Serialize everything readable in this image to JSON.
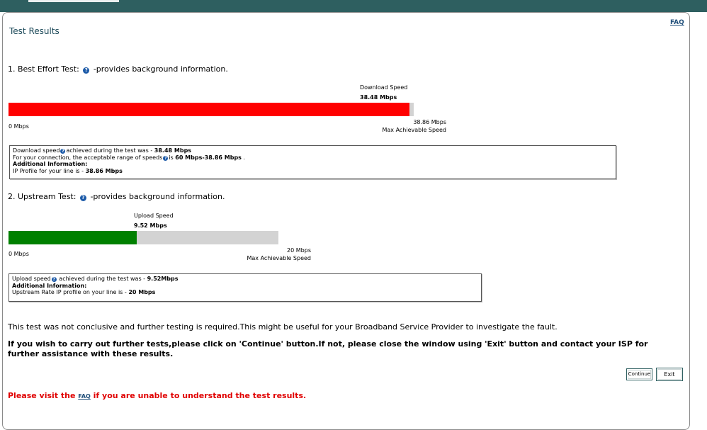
{
  "header": {
    "faq_label": "FAQ",
    "title": "Test Results"
  },
  "best_effort": {
    "heading_prefix": "1. Best Effort Test:",
    "heading_suffix": "-provides background information.",
    "bar_label": "Download Speed",
    "bar_value": "38.48 Mbps",
    "min_label": "0 Mbps",
    "max_value": "38.86 Mbps",
    "max_label": "Max Achievable Speed",
    "fill_fraction": 0.9902,
    "fill_color": "#ff0000",
    "info": {
      "line1_prefix": "Download speed",
      "line1_middle": "achieved during the test was - ",
      "line1_value": "38.48 Mbps",
      "line2_prefix": "For your connection, the acceptable range of speeds",
      "line2_middle": "is ",
      "line2_value": "60 Mbps-38.86 Mbps",
      "line2_end": " .",
      "line3": "Additional Information:",
      "line4_prefix": "IP Profile for your line is - ",
      "line4_value": "38.86 Mbps"
    }
  },
  "upstream": {
    "heading_prefix": "2. Upstream Test:",
    "heading_suffix": "-provides background information.",
    "bar_label": "Upload Speed",
    "bar_value": "9.52 Mbps",
    "min_label": "0 Mbps",
    "max_value": "20 Mbps",
    "max_label": "Max Achievable Speed",
    "fill_fraction": 0.476,
    "fill_color": "#008000",
    "info": {
      "line1_prefix": "Upload speed",
      "line1_middle": " achieved during the test was - ",
      "line1_value": "9.52Mbps",
      "line2": "Additional Information:",
      "line3_prefix": "Upstream Rate IP profile on your line is - ",
      "line3_value": "20 Mbps"
    }
  },
  "messages": {
    "inconclusive": "This test was not conclusive and further testing is required.This might be useful for your Broadband Service Provider to investigate the fault.",
    "instructions": "If you wish to carry out further tests,please click on 'Continue' button.If not, please close the window using 'Exit' button and contact your ISP for further assistance with these results.",
    "visit_prefix": "Please visit the ",
    "visit_link": "FAQ",
    "visit_suffix": " if you are unable to understand the test results."
  },
  "buttons": {
    "continue_label": "Continue",
    "exit_label": "Exit"
  },
  "icons": {
    "help": "help-icon",
    "help_glyph": "?"
  },
  "colors": {
    "topbar": "#2e5f60",
    "title": "#1d4a5a",
    "link": "#1f4e79",
    "warning": "#e00000"
  }
}
